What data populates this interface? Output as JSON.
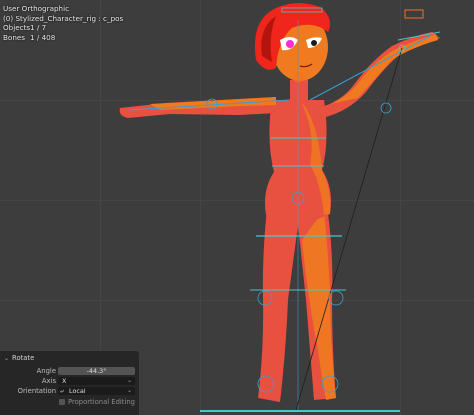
{
  "viewport": {
    "view_name": "User Orthographic",
    "object_info": "(0) Stylized_Character_rig : c_pos",
    "stats": [
      {
        "label": "Objects",
        "value": "1 / 7"
      },
      {
        "label": "Bones",
        "value": "1 / 408"
      }
    ]
  },
  "operator_panel": {
    "title": "Rotate",
    "angle": {
      "label": "Angle",
      "value": "-44.3°"
    },
    "axis": {
      "label": "Axis",
      "value": "X"
    },
    "orientation": {
      "label": "Orientation",
      "value": "Local"
    },
    "proportional_editing": {
      "label": "Proportional Editing",
      "checked": false
    }
  },
  "colors": {
    "background": "#3d3d3d",
    "body": "#e8503f",
    "body_light": "#f07a1f",
    "hair": "#f0261d",
    "hair_dark": "#b3140c",
    "eye": "#ff2bd1",
    "bone_blue": "#3c9fd0",
    "bone_cyan": "#47c6c8",
    "control_orange": "#ff6a1a",
    "panel": "#262626"
  },
  "icons": [
    "chevron-down-icon",
    "orientation-local-icon",
    "dropdown-arrow-icon",
    "checkbox-icon"
  ]
}
